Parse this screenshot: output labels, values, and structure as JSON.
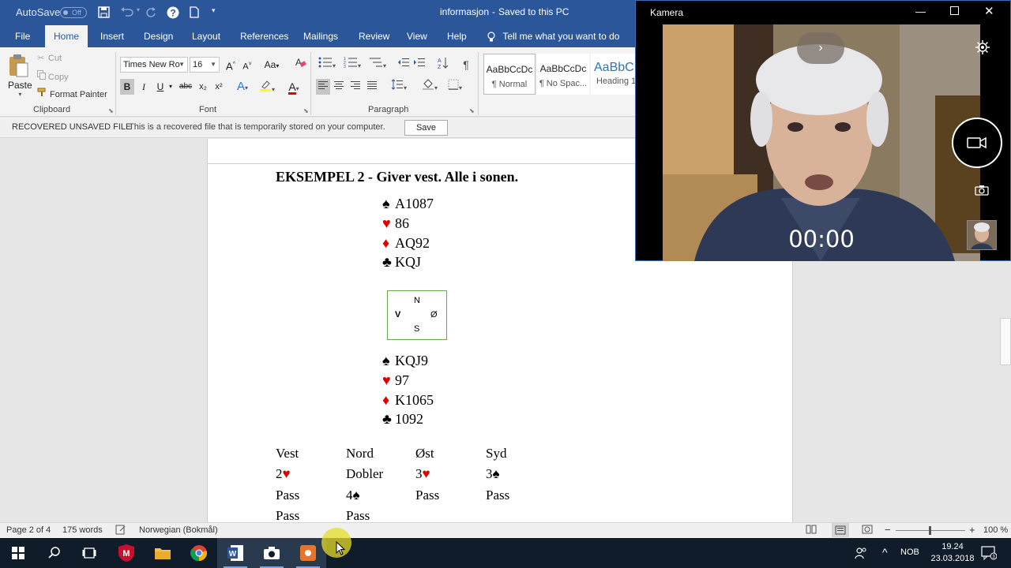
{
  "titlebar": {
    "autosave_label": "AutoSave",
    "autosave_state": "Off",
    "doc_name": "informasjon",
    "separator": "-",
    "save_status": "Saved to this PC"
  },
  "tabs": {
    "file": "File",
    "home": "Home",
    "insert": "Insert",
    "design": "Design",
    "layout": "Layout",
    "references": "References",
    "mailings": "Mailings",
    "review": "Review",
    "view": "View",
    "help": "Help",
    "tell_me": "Tell me what you want to do"
  },
  "clipboard": {
    "paste": "Paste",
    "cut": "Cut",
    "copy": "Copy",
    "format_painter": "Format Painter",
    "group_label": "Clipboard"
  },
  "font": {
    "family": "Times New Ro",
    "size": "16",
    "grow": "A",
    "shrink": "A",
    "case": "Aa",
    "bold": "B",
    "italic": "I",
    "underline": "U",
    "strike": "abc",
    "sub": "x₂",
    "sup": "x²",
    "text_effects": "A",
    "font_color": "A",
    "group_label": "Font"
  },
  "paragraph": {
    "group_label": "Paragraph"
  },
  "styles": [
    {
      "preview": "AaBbCcDc",
      "name": "¶ Normal"
    },
    {
      "preview": "AaBbCcDc",
      "name": "¶ No Spac..."
    },
    {
      "preview": "AaBbC",
      "name": "Heading 1"
    }
  ],
  "recovered": {
    "title": "RECOVERED UNSAVED FILE",
    "message": "This is a recovered file that is temporarily stored on your computer.",
    "save": "Save"
  },
  "document": {
    "heading": "EKSEMPEL 2 - Giver vest. Alle i sonen.",
    "north": [
      {
        "suit": "♠",
        "cards": "A1087"
      },
      {
        "suit": "♥",
        "cards": "86"
      },
      {
        "suit": "♦",
        "cards": "AQ92"
      },
      {
        "suit": "♣",
        "cards": "KQJ"
      }
    ],
    "south": [
      {
        "suit": "♠",
        "cards": "KQJ9"
      },
      {
        "suit": "♥",
        "cards": "97"
      },
      {
        "suit": "♦",
        "cards": "K1065"
      },
      {
        "suit": "♣",
        "cards": "1092"
      }
    ],
    "compass": {
      "n": "N",
      "w": "V",
      "e": "Ø",
      "s": "S"
    },
    "bidding": {
      "headers": [
        "Vest",
        "Nord",
        "Øst",
        "Syd"
      ],
      "rows": [
        [
          {
            "t": "2",
            "s": "♥"
          },
          {
            "t": "Dobler",
            "s": ""
          },
          {
            "t": "3",
            "s": "♥"
          },
          {
            "t": "3",
            "s": "♠"
          }
        ],
        [
          {
            "t": "Pass",
            "s": ""
          },
          {
            "t": "4",
            "s": "♠"
          },
          {
            "t": "Pass",
            "s": ""
          },
          {
            "t": "Pass",
            "s": ""
          }
        ],
        [
          {
            "t": "Pass",
            "s": ""
          },
          {
            "t": "Pass",
            "s": ""
          }
        ]
      ]
    }
  },
  "statusbar": {
    "page": "Page 2 of 4",
    "words": "175 words",
    "language": "Norwegian (Bokmål)",
    "zoom": "100 %"
  },
  "camera": {
    "title": "Kamera",
    "timer": "00:00"
  },
  "taskbar": {
    "lang": "NOB",
    "time": "19.24",
    "date": "23.03.2018"
  },
  "colors": {
    "word_blue": "#2b579a",
    "suit_red": "#e00000",
    "taskbar": "#101c2a"
  }
}
